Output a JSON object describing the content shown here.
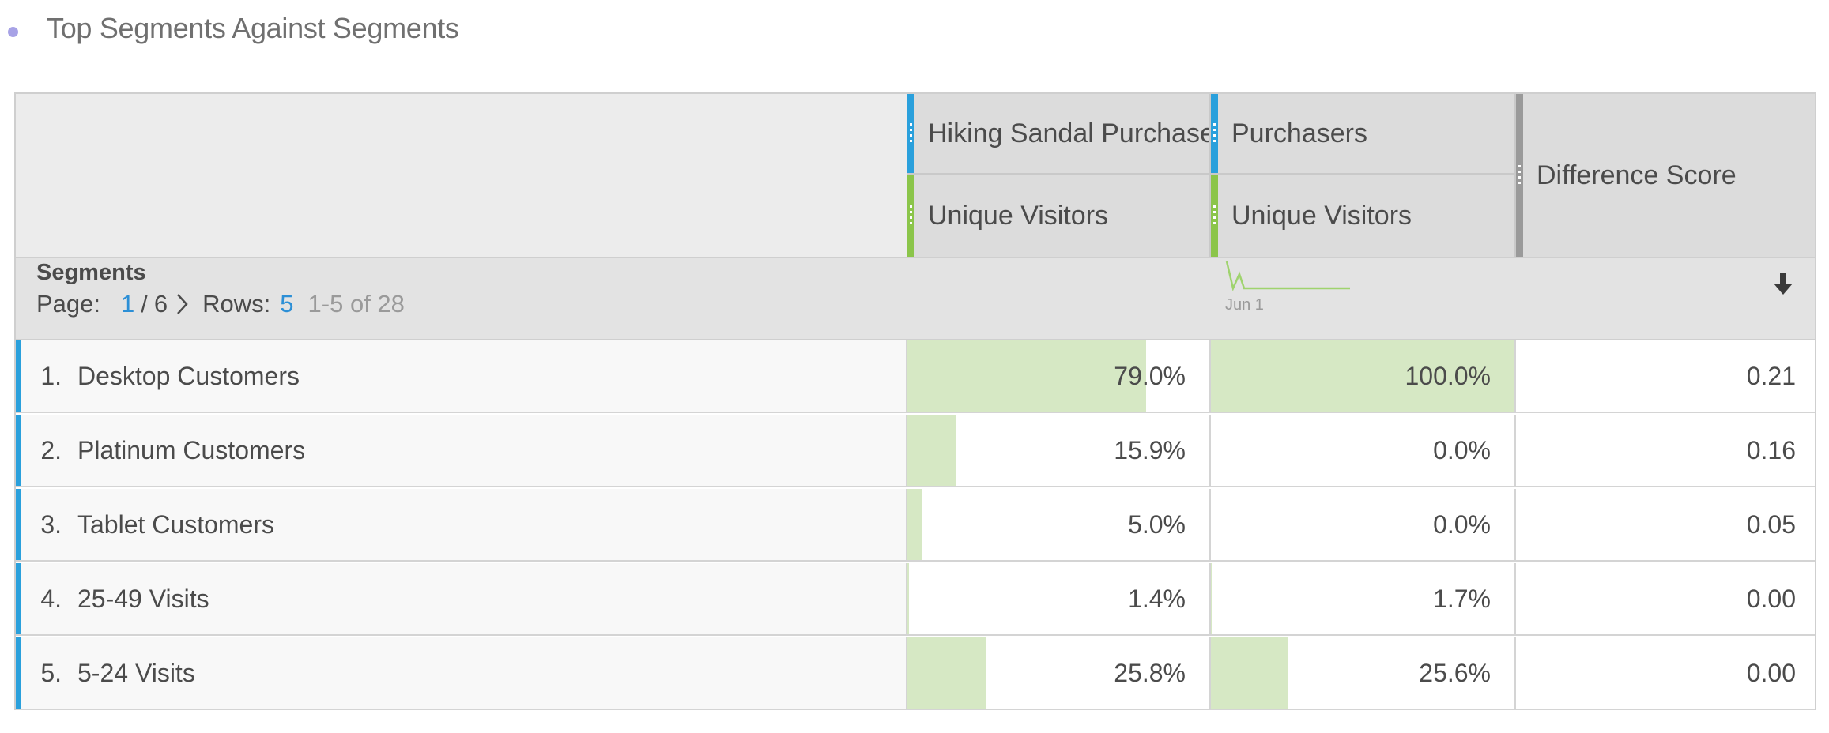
{
  "panel": {
    "title": "Top Segments Against Segments"
  },
  "columns": [
    {
      "segment": "Hiking Sandal Purchasers",
      "metric": "Unique Visitors"
    },
    {
      "segment": "Purchasers",
      "metric": "Unique Visitors"
    }
  ],
  "difference_label": "Difference Score",
  "segments_label": "Segments",
  "pager": {
    "page_label": "Page:",
    "current": "1",
    "sep": "/",
    "total": "6",
    "rows_label": "Rows:",
    "rows_value": "5",
    "range": "1-5 of 28"
  },
  "sparkline_label": "Jun 1",
  "icons": {
    "sort": "sort-down-arrow-icon",
    "next_page": "chevron-right-icon"
  },
  "colors": {
    "segment_tag": "#2aa0dc",
    "metric_tag": "#8bc54a",
    "bar_fill": "#d6e8c4",
    "link": "#2c8fd6"
  },
  "rows": [
    {
      "num": "1.",
      "name": "Desktop Customers",
      "a": "79.0%",
      "a_pct": 0.79,
      "b": "100.0%",
      "b_pct": 1.0,
      "diff": "0.21"
    },
    {
      "num": "2.",
      "name": "Platinum Customers",
      "a": "15.9%",
      "a_pct": 0.159,
      "b": "0.0%",
      "b_pct": 0.0,
      "diff": "0.16"
    },
    {
      "num": "3.",
      "name": "Tablet Customers",
      "a": "5.0%",
      "a_pct": 0.05,
      "b": "0.0%",
      "b_pct": 0.0,
      "diff": "0.05"
    },
    {
      "num": "4.",
      "name": "25-49 Visits",
      "a": "1.4%",
      "a_pct": 0.014,
      "b": "1.7%",
      "b_pct": 0.017,
      "diff": "0.00"
    },
    {
      "num": "5.",
      "name": "5-24 Visits",
      "a": "25.8%",
      "a_pct": 0.258,
      "b": "25.6%",
      "b_pct": 0.256,
      "diff": "0.00"
    }
  ]
}
